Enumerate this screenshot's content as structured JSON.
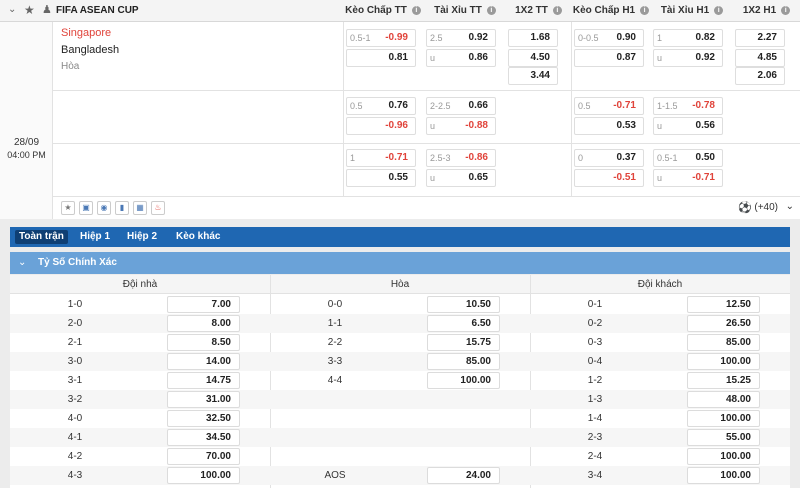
{
  "header": {
    "league": "FIFA ASEAN CUP",
    "columns": [
      "Kèo Chấp TT",
      "Tài Xỉu TT",
      "1X2 TT",
      "Kèo Chấp H1",
      "Tài Xỉu H1",
      "1X2 H1"
    ],
    "icons": [
      "chevron-down-icon",
      "star-icon",
      "trophy-icon",
      "info-icon"
    ]
  },
  "match": {
    "date": "28/09",
    "time": "04:00 PM",
    "home": "Singapore",
    "away": "Bangladesh",
    "draw_label": "Hòa",
    "odds_rows": [
      {
        "hdp_tt": [
          {
            "h": "0.5-1",
            "v": "-0.99"
          },
          {
            "h": "",
            "v": "0.81"
          }
        ],
        "ou_tt": [
          {
            "h": "2.5",
            "v": "0.92"
          },
          {
            "h": "u",
            "v": "0.86"
          }
        ],
        "x12_tt": [
          "1.68",
          "4.50",
          "3.44"
        ],
        "hdp_h1": [
          {
            "h": "0-0.5",
            "v": "0.90"
          },
          {
            "h": "",
            "v": "0.87"
          }
        ],
        "ou_h1": [
          {
            "h": "1",
            "v": "0.82"
          },
          {
            "h": "u",
            "v": "0.92"
          }
        ],
        "x12_h1": [
          "2.27",
          "4.85",
          "2.06"
        ]
      },
      {
        "hdp_tt": [
          {
            "h": "0.5",
            "v": "0.76"
          },
          {
            "h": "",
            "v": "-0.96"
          }
        ],
        "ou_tt": [
          {
            "h": "2-2.5",
            "v": "0.66"
          },
          {
            "h": "u",
            "v": "-0.88"
          }
        ],
        "hdp_h1": [
          {
            "h": "0.5",
            "v": "-0.71"
          },
          {
            "h": "",
            "v": "0.53"
          }
        ],
        "ou_h1": [
          {
            "h": "1-1.5",
            "v": "-0.78"
          },
          {
            "h": "u",
            "v": "0.56"
          }
        ]
      },
      {
        "hdp_tt": [
          {
            "h": "1",
            "v": "-0.71"
          },
          {
            "h": "",
            "v": "0.55"
          }
        ],
        "ou_tt": [
          {
            "h": "2.5-3",
            "v": "-0.86"
          },
          {
            "h": "u",
            "v": "0.65"
          }
        ],
        "hdp_h1": [
          {
            "h": "0",
            "v": "0.37"
          },
          {
            "h": "",
            "v": "-0.51"
          }
        ],
        "ou_h1": [
          {
            "h": "0.5-1",
            "v": "0.50"
          },
          {
            "h": "u",
            "v": "-0.71"
          }
        ]
      }
    ],
    "action_icons": [
      "star-icon",
      "database-icon",
      "eye-icon",
      "bar-chart-icon",
      "table-icon",
      "fire-icon"
    ],
    "more_label": "(+40)"
  },
  "tabs": [
    "Toàn trận",
    "Hiệp 1",
    "Hiệp 2",
    "Kèo khác"
  ],
  "section": {
    "title": "Tỷ Số Chính Xác",
    "headers": [
      "Đội nhà",
      "Hòa",
      "Đội khách"
    ],
    "home": [
      [
        "1-0",
        "7.00"
      ],
      [
        "2-0",
        "8.00"
      ],
      [
        "2-1",
        "8.50"
      ],
      [
        "3-0",
        "14.00"
      ],
      [
        "3-1",
        "14.75"
      ],
      [
        "3-2",
        "31.00"
      ],
      [
        "4-0",
        "32.50"
      ],
      [
        "4-1",
        "34.50"
      ],
      [
        "4-2",
        "70.00"
      ],
      [
        "4-3",
        "100.00"
      ]
    ],
    "draw": [
      [
        "0-0",
        "10.50"
      ],
      [
        "1-1",
        "6.50"
      ],
      [
        "2-2",
        "15.75"
      ],
      [
        "3-3",
        "85.00"
      ],
      [
        "4-4",
        "100.00"
      ],
      [
        "",
        ""
      ],
      [
        "",
        ""
      ],
      [
        "",
        ""
      ],
      [
        "",
        ""
      ],
      [
        "AOS",
        "24.00"
      ]
    ],
    "away": [
      [
        "0-1",
        "12.50"
      ],
      [
        "0-2",
        "26.50"
      ],
      [
        "0-3",
        "85.00"
      ],
      [
        "0-4",
        "100.00"
      ],
      [
        "1-2",
        "15.25"
      ],
      [
        "1-3",
        "48.00"
      ],
      [
        "1-4",
        "100.00"
      ],
      [
        "2-3",
        "55.00"
      ],
      [
        "2-4",
        "100.00"
      ],
      [
        "3-4",
        "100.00"
      ]
    ]
  },
  "colors": {
    "negative": "#e0433a",
    "tabbar": "#1f67b2",
    "section": "#6aa2d8",
    "home_team": "#e0433a"
  }
}
